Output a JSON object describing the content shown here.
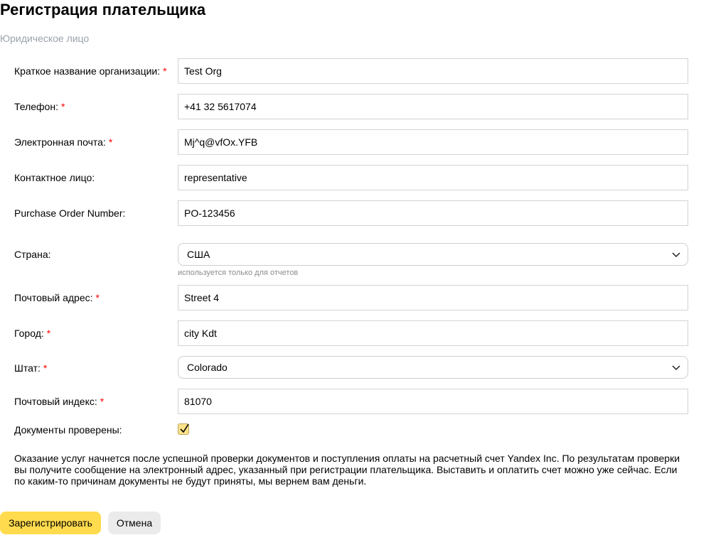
{
  "page": {
    "title": "Регистрация плательщика",
    "subtitle": "Юридическое лицо"
  },
  "form": {
    "required_mark": "*",
    "org_name": {
      "label": "Краткое название организации:",
      "value": "Test Org",
      "required": true
    },
    "phone": {
      "label": "Телефон:",
      "value": "+41 32 5617074",
      "required": true
    },
    "email": {
      "label": "Электронная почта:",
      "value": "Mj^q@vfOx.YFB",
      "required": true
    },
    "contact": {
      "label": "Контактное лицо:",
      "value": "representative",
      "required": false
    },
    "po_number": {
      "label": "Purchase Order Number:",
      "value": "PO-123456",
      "required": false
    },
    "country": {
      "label": "Страна:",
      "value": "США",
      "hint": "используется только для отчетов",
      "required": false
    },
    "address": {
      "label": "Почтовый адрес:",
      "value": "Street 4",
      "required": true
    },
    "city": {
      "label": "Город:",
      "value": "city Kdt",
      "required": true
    },
    "state": {
      "label": "Штат:",
      "value": "Colorado",
      "required": true
    },
    "zip": {
      "label": "Почтовый индекс:",
      "value": "81070",
      "required": true
    },
    "docs_checked": {
      "label": "Документы проверены:",
      "checked": true
    }
  },
  "notice": "Оказание услуг начнется после успешной проверки документов и поступления оплаты на расчетный счет Yandex Inc. По результатам проверки вы получите сообщение на электронный адрес, указанный при регистрации плательщика. Выставить и оплатить счет можно уже сейчас. Если по каким-то причинам документы не будут приняты, мы вернем вам деньги.",
  "actions": {
    "submit_label": "Зарегистрировать",
    "cancel_label": "Отмена"
  },
  "colors": {
    "required": "#ff0000",
    "primary_button": "#ffdb4d",
    "secondary_button": "#ebebeb",
    "checkbox_fill": "#ffe38a"
  },
  "icons": {
    "select_arrow": "chevron-down-icon",
    "checkbox_mark": "check-icon"
  }
}
